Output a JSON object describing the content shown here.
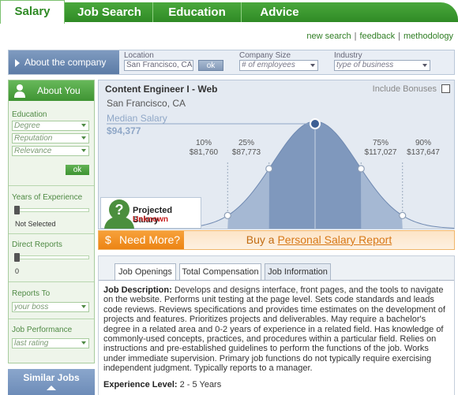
{
  "nav": {
    "tabs": [
      "Salary",
      "Job Search",
      "Education",
      "Advice"
    ],
    "links": [
      "new search",
      "feedback",
      "methodology"
    ]
  },
  "company": {
    "about_label": "About the company",
    "location_label": "Location",
    "location_value": "San Francisco, CA",
    "ok_label": "ok",
    "size_label": "Company Size",
    "size_value": "# of employees",
    "industry_label": "Industry",
    "industry_value": "type of business"
  },
  "sidebar": {
    "title": "About You",
    "education_label": "Education",
    "education_options": [
      "Degree",
      "Reputation",
      "Relevance"
    ],
    "ok_label": "ok",
    "experience_label": "Years of Experience",
    "experience_value": "Not Selected",
    "reports_label": "Direct Reports",
    "reports_value": "0",
    "reports_to_label": "Reports To",
    "reports_to_value": "your boss",
    "performance_label": "Job Performance",
    "performance_value": "last rating",
    "similar_label": "Similar Jobs"
  },
  "chart_data": {
    "type": "area",
    "title": "Content Engineer I - Web",
    "location": "San Francisco, CA",
    "median_label": "Median Salary",
    "median_value": "$94,377",
    "bonus_label": "Include Bonuses",
    "percentiles": [
      {
        "pct": "10%",
        "value": "$81,760",
        "amount": 81760
      },
      {
        "pct": "25%",
        "value": "$87,773",
        "amount": 87773
      },
      {
        "pct": "75%",
        "value": "$117,027",
        "amount": 117027
      },
      {
        "pct": "90%",
        "value": "$137,647",
        "amount": 137647
      }
    ],
    "median_amount": 94377
  },
  "projected": {
    "title": "Projected Salary",
    "value": "Unknown"
  },
  "need_more": {
    "left": "Need More?",
    "prefix": "Buy a ",
    "link": "Personal Salary Report"
  },
  "info_tabs": [
    "Job Openings",
    "Total Compensation",
    "Job Information"
  ],
  "description": {
    "label": "Job Description:",
    "text": "Develops and designs interface, front pages, and the tools to navigate on the website. Performs unit testing at the page level. Sets code standards and leads code reviews. Reviews specifications and provides time estimates on the development of projects and features. Prioritizes projects and deliverables. May require a bachelor's degree in a related area and 0-2 years of experience in a related field. Has knowledge of commonly-used concepts, practices, and procedures within a particular field. Relies on instructions and pre-established guidelines to perform the functions of the job. Works under immediate supervision. Primary job functions do not typically require exercising independent judgment. Typically reports to a manager.",
    "experience_label": "Experience Level:",
    "experience_value": "2 - 5 Years"
  }
}
